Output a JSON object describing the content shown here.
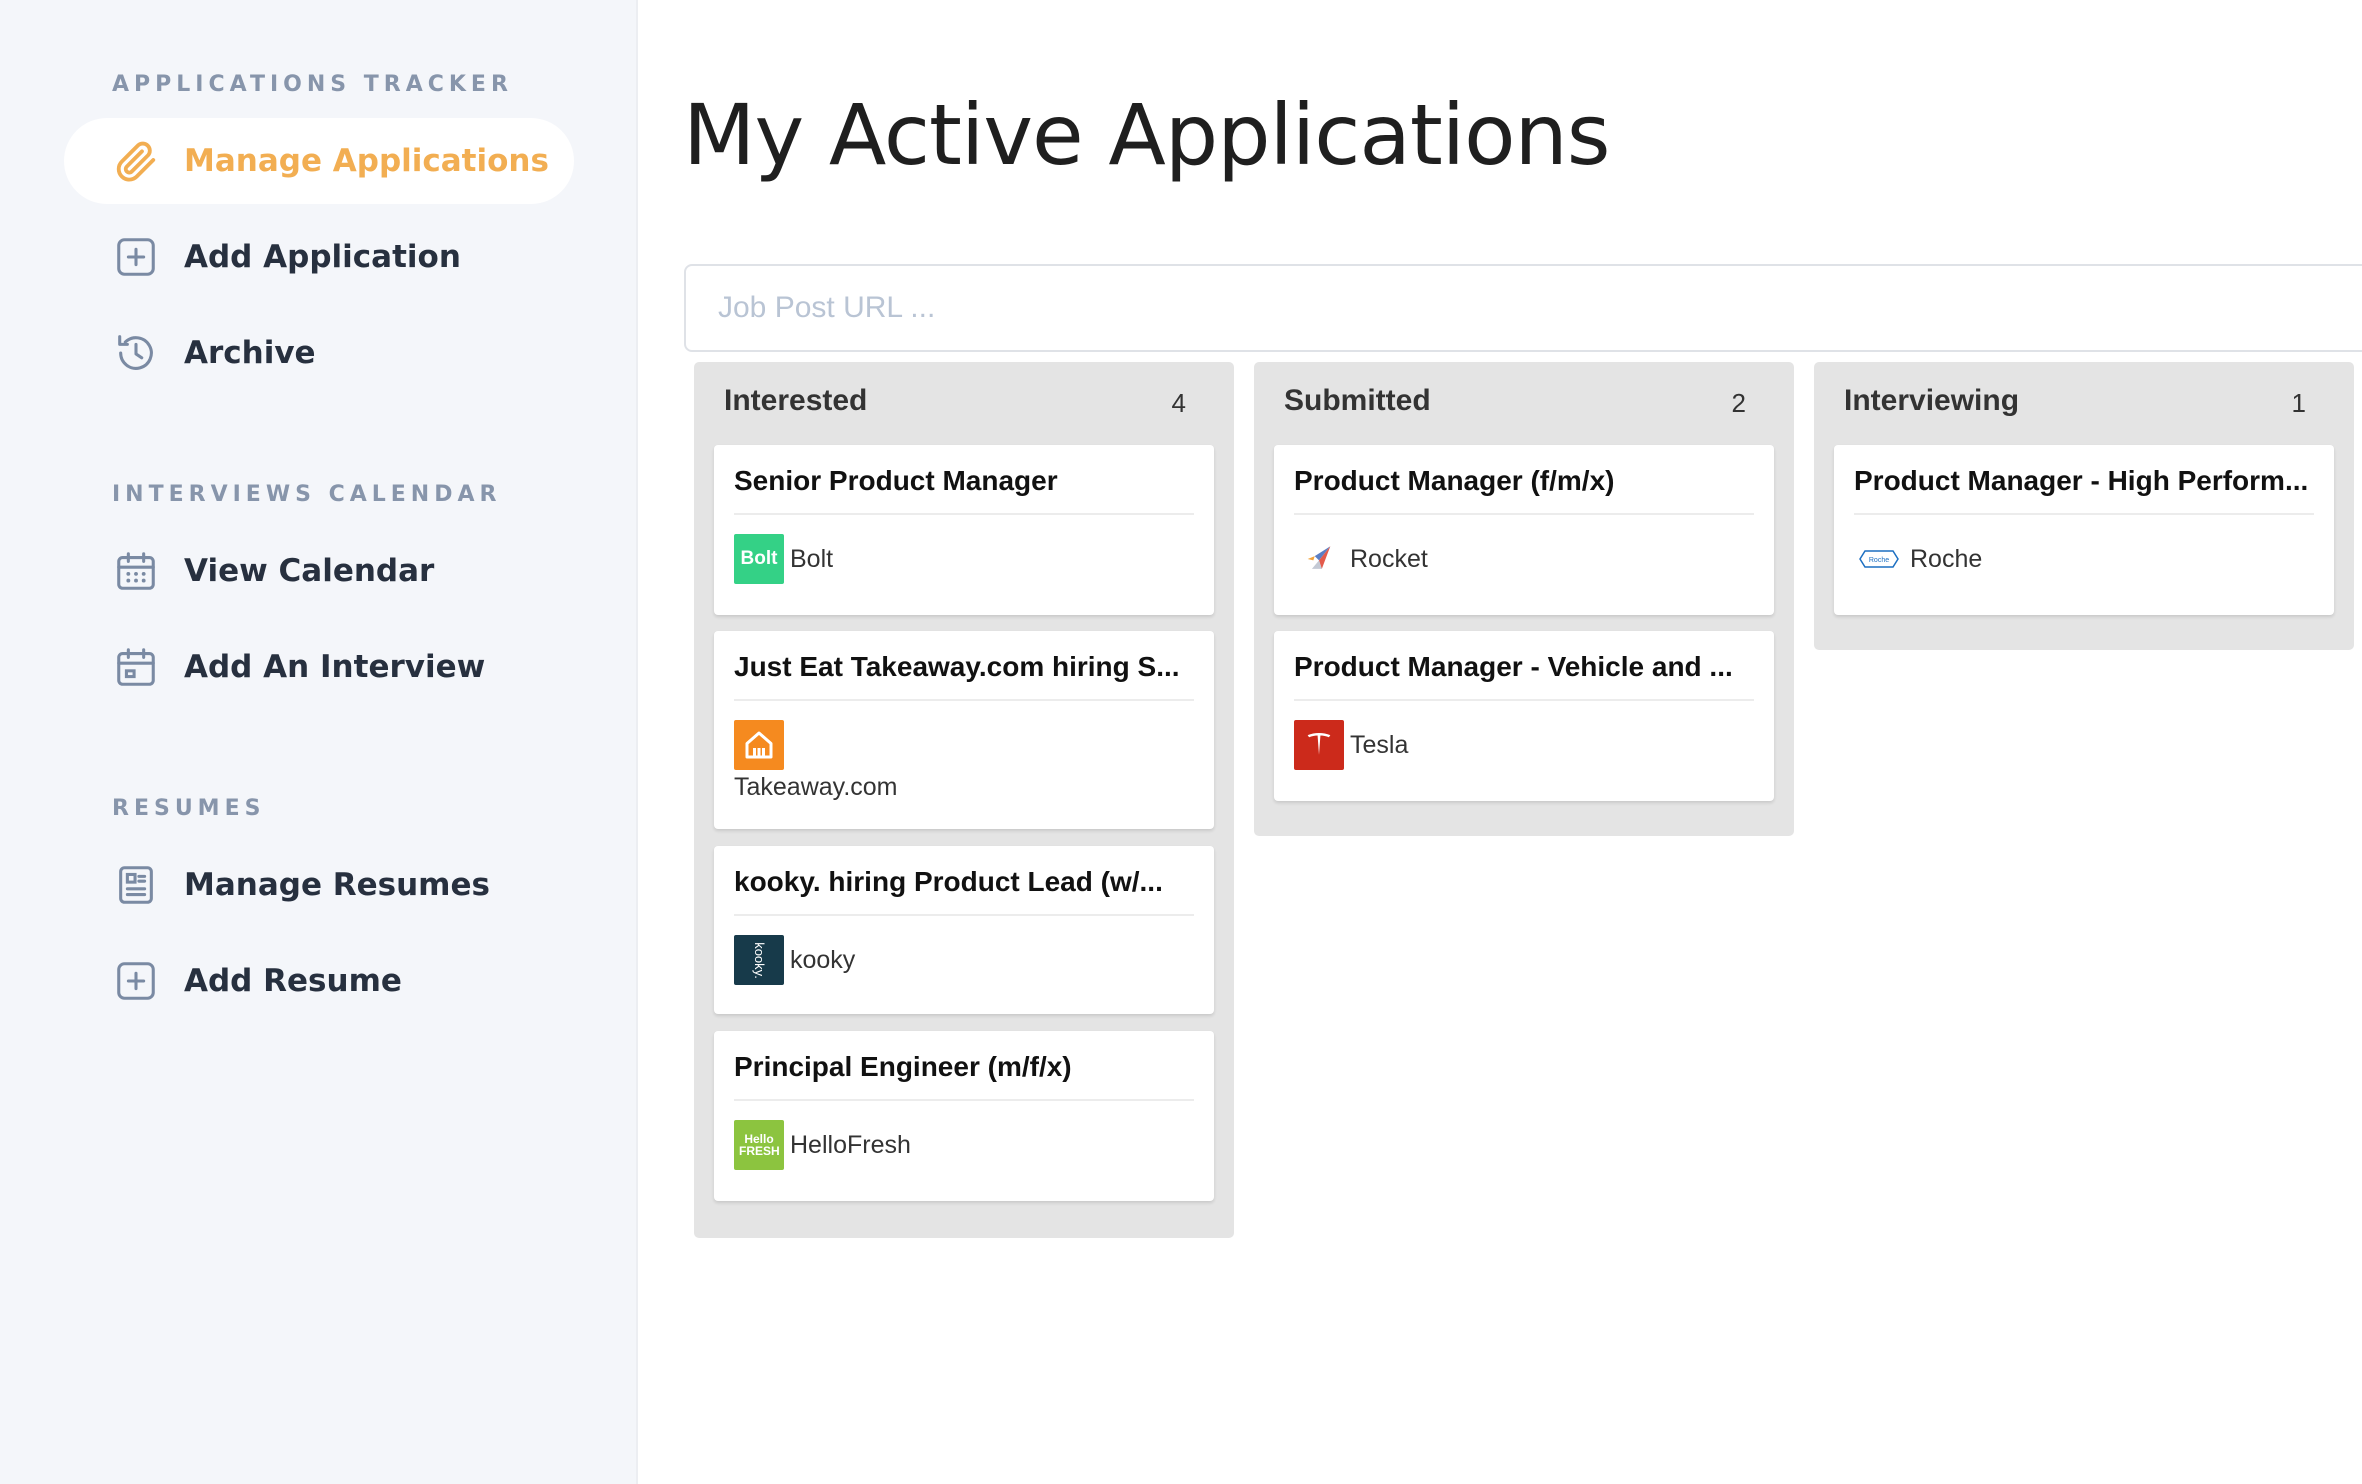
{
  "sidebar": {
    "sections": [
      {
        "title": "APPLICATIONS TRACKER",
        "items": [
          {
            "label": "Manage Applications",
            "icon": "paperclip-icon",
            "active": true
          },
          {
            "label": "Add Application",
            "icon": "plus-square-icon"
          },
          {
            "label": "Archive",
            "icon": "history-icon"
          }
        ]
      },
      {
        "title": "INTERVIEWS CALENDAR",
        "items": [
          {
            "label": "View Calendar",
            "icon": "calendar-icon"
          },
          {
            "label": "Add An Interview",
            "icon": "calendar-add-icon"
          }
        ]
      },
      {
        "title": "RESUMES",
        "items": [
          {
            "label": "Manage Resumes",
            "icon": "document-icon"
          },
          {
            "label": "Add Resume",
            "icon": "plus-square-icon"
          }
        ]
      }
    ]
  },
  "main": {
    "title": "My Active Applications",
    "job_url_placeholder": "Job Post URL ..."
  },
  "board": {
    "columns": [
      {
        "name": "Interested",
        "count": "4",
        "cards": [
          {
            "title": "Senior Product Manager",
            "company": "Bolt",
            "logo_text": "Bolt",
            "logo_color": "#34d186"
          },
          {
            "title": "Just Eat Takeaway.com hiring S...",
            "company": "Takeaway.com",
            "logo_color": "#f58a1f"
          },
          {
            "title": "kooky. hiring Product Lead (w/...",
            "company": "kooky",
            "logo_text": "kooky.",
            "logo_color": "#173a4a"
          },
          {
            "title": "Principal Engineer (m/f/x)",
            "company": "HelloFresh",
            "logo_text": "Hello FRESH",
            "logo_color": "#8cc43f"
          }
        ]
      },
      {
        "name": "Submitted",
        "count": "2",
        "cards": [
          {
            "title": "Product Manager (f/m/x)",
            "company": "Rocket"
          },
          {
            "title": "Product Manager - Vehicle and ...",
            "company": "Tesla",
            "logo_color": "#cc2a1b"
          }
        ]
      },
      {
        "name": "Interviewing",
        "count": "1",
        "cards": [
          {
            "title": "Product Manager - High Perform...",
            "company": "Roche",
            "logo_text": "Roche",
            "logo_color": "#1c6fc1"
          }
        ]
      }
    ]
  },
  "colors": {
    "accent": "#f2ae52",
    "sidebar_bg": "#f4f6fa",
    "section_title": "#8795ab",
    "column_bg": "#e4e4e4"
  }
}
